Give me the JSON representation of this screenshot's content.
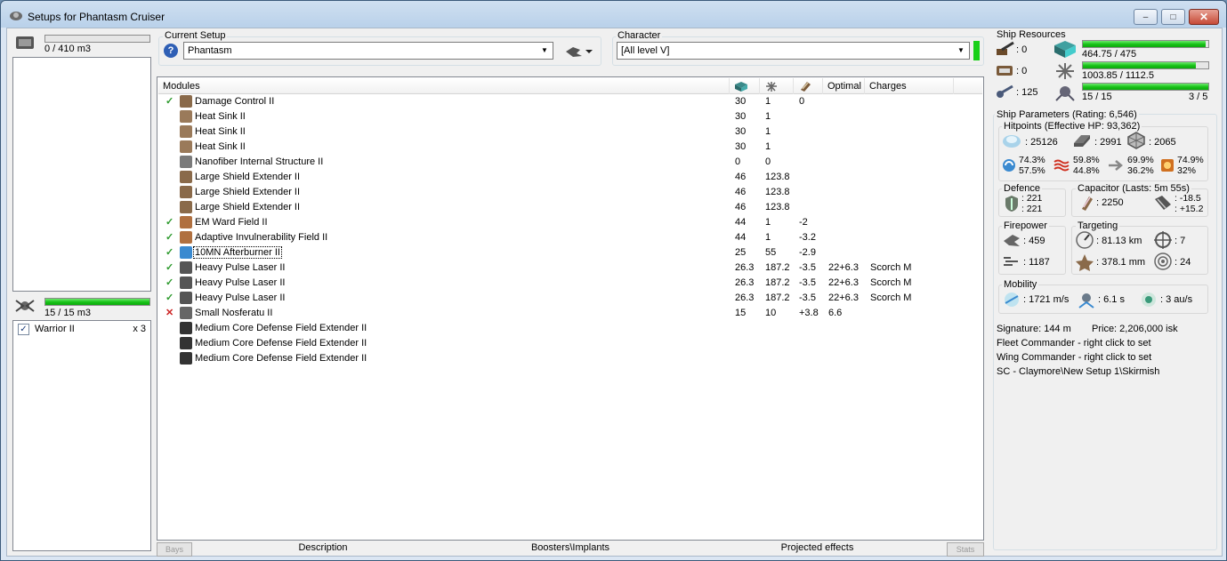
{
  "window": {
    "title": "Setups for Phantasm Cruiser",
    "minimize": "–",
    "maximize": "□",
    "close": "✕"
  },
  "left": {
    "cargo": {
      "text": "0 / 410 m3",
      "fraction": 0.0
    },
    "drone_bay": {
      "text": "15 / 15 m3",
      "fraction": 1.0
    },
    "drones": [
      {
        "name": "Warrior II",
        "qty": "x 3",
        "checked": true
      }
    ]
  },
  "setup": {
    "label": "Current Setup",
    "value": "Phantasm",
    "help": "?"
  },
  "character": {
    "label": "Character",
    "value": "[All level V]"
  },
  "modules": {
    "headers": {
      "name": "Modules",
      "optimal": "Optimal",
      "charges": "Charges"
    },
    "rows": [
      {
        "status": "ok",
        "icon": "damage-control-icon",
        "name": "Damage Control II",
        "cpu": "30",
        "pg": "1",
        "cap": "0",
        "optimal": "",
        "charges": ""
      },
      {
        "status": "",
        "icon": "heat-sink-icon",
        "name": "Heat Sink II",
        "cpu": "30",
        "pg": "1",
        "cap": "",
        "optimal": "",
        "charges": ""
      },
      {
        "status": "",
        "icon": "heat-sink-icon",
        "name": "Heat Sink II",
        "cpu": "30",
        "pg": "1",
        "cap": "",
        "optimal": "",
        "charges": ""
      },
      {
        "status": "",
        "icon": "heat-sink-icon",
        "name": "Heat Sink II",
        "cpu": "30",
        "pg": "1",
        "cap": "",
        "optimal": "",
        "charges": ""
      },
      {
        "status": "",
        "icon": "nanofiber-icon",
        "name": "Nanofiber Internal Structure II",
        "cpu": "0",
        "pg": "0",
        "cap": "",
        "optimal": "",
        "charges": ""
      },
      {
        "status": "",
        "icon": "shield-extender-icon",
        "name": "Large Shield Extender II",
        "cpu": "46",
        "pg": "123.8",
        "cap": "",
        "optimal": "",
        "charges": ""
      },
      {
        "status": "",
        "icon": "shield-extender-icon",
        "name": "Large Shield Extender II",
        "cpu": "46",
        "pg": "123.8",
        "cap": "",
        "optimal": "",
        "charges": ""
      },
      {
        "status": "",
        "icon": "shield-extender-icon",
        "name": "Large Shield Extender II",
        "cpu": "46",
        "pg": "123.8",
        "cap": "",
        "optimal": "",
        "charges": ""
      },
      {
        "status": "ok",
        "icon": "ward-field-icon",
        "name": "EM Ward Field II",
        "cpu": "44",
        "pg": "1",
        "cap": "-2",
        "optimal": "",
        "charges": ""
      },
      {
        "status": "ok",
        "icon": "invuln-field-icon",
        "name": "Adaptive Invulnerability Field II",
        "cpu": "44",
        "pg": "1",
        "cap": "-3.2",
        "optimal": "",
        "charges": ""
      },
      {
        "status": "ok",
        "icon": "afterburner-icon",
        "name": "10MN Afterburner II",
        "cpu": "25",
        "pg": "55",
        "cap": "-2.9",
        "optimal": "",
        "charges": "",
        "selected": true
      },
      {
        "status": "ok",
        "icon": "pulse-laser-icon",
        "name": "Heavy Pulse Laser II",
        "cpu": "26.3",
        "pg": "187.2",
        "cap": "-3.5",
        "optimal": "22+6.3",
        "charges": "Scorch M"
      },
      {
        "status": "ok",
        "icon": "pulse-laser-icon",
        "name": "Heavy Pulse Laser II",
        "cpu": "26.3",
        "pg": "187.2",
        "cap": "-3.5",
        "optimal": "22+6.3",
        "charges": "Scorch M"
      },
      {
        "status": "ok",
        "icon": "pulse-laser-icon",
        "name": "Heavy Pulse Laser II",
        "cpu": "26.3",
        "pg": "187.2",
        "cap": "-3.5",
        "optimal": "22+6.3",
        "charges": "Scorch M"
      },
      {
        "status": "bad",
        "icon": "nosferatu-icon",
        "name": "Small Nosferatu II",
        "cpu": "15",
        "pg": "10",
        "cap": "+3.8",
        "optimal": "6.6",
        "charges": ""
      },
      {
        "status": "",
        "icon": "rig-icon",
        "name": "Medium Core Defense Field Extender II",
        "cpu": "",
        "pg": "",
        "cap": "",
        "optimal": "",
        "charges": ""
      },
      {
        "status": "",
        "icon": "rig-icon",
        "name": "Medium Core Defense Field Extender II",
        "cpu": "",
        "pg": "",
        "cap": "",
        "optimal": "",
        "charges": ""
      },
      {
        "status": "",
        "icon": "rig-icon",
        "name": "Medium Core Defense Field Extender II",
        "cpu": "",
        "pg": "",
        "cap": "",
        "optimal": "",
        "charges": ""
      }
    ]
  },
  "bottom_tabs": {
    "left_btn": "Bays",
    "description": "Description",
    "boosters": "Boosters\\Implants",
    "projected": "Projected effects",
    "right_btn": "Stats"
  },
  "resources": {
    "title": "Ship Resources",
    "turrets": ": 0",
    "launchers": ": 0",
    "calibration": ": 125",
    "cpu": {
      "text": "464.75 / 475",
      "fraction": 0.978
    },
    "powergrid": {
      "text": "1003.85 / 1112.5",
      "fraction": 0.902
    },
    "drone_bw": {
      "text": "15 / 15",
      "fraction": 1.0
    },
    "drones_active": "3 / 5"
  },
  "params": {
    "title": "Ship Parameters (Rating: 6,546)",
    "hitpoints": {
      "title": "Hitpoints (Effective HP: 93,362)",
      "shield": ": 25126",
      "armor": ": 2991",
      "structure": ": 2065",
      "res": [
        [
          "74.3%",
          "57.5%"
        ],
        [
          "59.8%",
          "44.8%"
        ],
        [
          "69.9%",
          "36.2%"
        ],
        [
          "74.9%",
          "32%"
        ]
      ]
    },
    "defence": {
      "title": "Defence",
      "a": ": 221",
      "b": ": 221"
    },
    "capacitor": {
      "title": "Capacitor (Lasts: 5m 55s)",
      "amount": ": 2250",
      "a": ": -18.5",
      "b": ": +15.2"
    },
    "firepower": {
      "title": "Firepower",
      "dps": ": 459",
      "volley": ": 1187"
    },
    "targeting": {
      "title": "Targeting",
      "range": ": 81.13 km",
      "targets": ": 7",
      "scan": ": 378.1 mm",
      "sensor": ": 24"
    },
    "mobility": {
      "title": "Mobility",
      "speed": ": 1721 m/s",
      "align": ": 6.1 s",
      "warp": ": 3 au/s"
    },
    "signature": "Signature: 144 m",
    "price": "Price: 2,206,000 isk",
    "fleet": "Fleet Commander - right click to set",
    "wing": "Wing Commander - right click to set",
    "squad": "SC - Claymore\\New Setup 1\\Skirmish"
  },
  "colors": {
    "ok": "#2e9a2e",
    "bad": "#cc2222",
    "bar": "#16c116"
  }
}
